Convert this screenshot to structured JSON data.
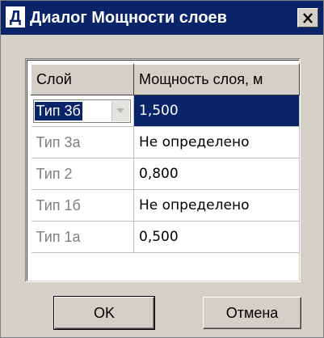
{
  "window": {
    "title": "Диалог Мощности слоев",
    "app_icon_letter": "Д",
    "close_symbol": "×"
  },
  "grid": {
    "columns": [
      "Слой",
      "Мощность слоя, м"
    ],
    "rows": [
      {
        "layer": "Тип 3б",
        "thickness": "1,500",
        "selected": true,
        "editing": true
      },
      {
        "layer": "Тип 3а",
        "thickness": "Не определено"
      },
      {
        "layer": "Тип 2",
        "thickness": "0,800"
      },
      {
        "layer": "Тип 1б",
        "thickness": "Не определено"
      },
      {
        "layer": "Тип 1а",
        "thickness": "0,500"
      }
    ]
  },
  "buttons": {
    "ok": "OK",
    "cancel": "Отмена"
  },
  "colors": {
    "titlebar": "#0a246a",
    "selection": "#0a246a",
    "face": "#d4d0c8"
  }
}
